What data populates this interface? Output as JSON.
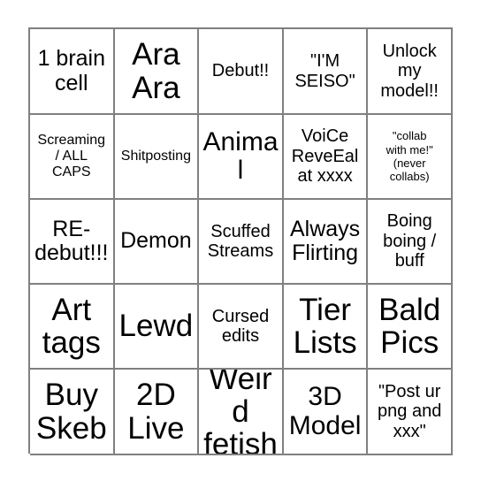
{
  "card": {
    "type": "bingo-card",
    "grid_size": "5x5",
    "border_color": "#808080",
    "background_color": "#ffffff",
    "text_color": "#000000",
    "rows": [
      [
        {
          "text": "1 brain\ncell",
          "size": "lg"
        },
        {
          "text": "Ara\nAra",
          "size": "xxl"
        },
        {
          "text": "Debut!!",
          "size": "md"
        },
        {
          "text": "\"I'M\nSEISO\"",
          "size": "md"
        },
        {
          "text": "Unlock\nmy\nmodel!!",
          "size": "md"
        }
      ],
      [
        {
          "text": "Screaming\n/ ALL\nCAPS",
          "size": "sm"
        },
        {
          "text": "Shitposting",
          "size": "sm"
        },
        {
          "text": "Animal",
          "size": "xl"
        },
        {
          "text": "VoiCe\nReveEal\nat xxxx",
          "size": "md"
        },
        {
          "text": "\"collab\nwith me!\"\n(never\ncollabs)",
          "size": "xs"
        }
      ],
      [
        {
          "text": "RE-\ndebut!!!",
          "size": "lg"
        },
        {
          "text": "Demon",
          "size": "lg"
        },
        {
          "text": "Scuffed\nStreams",
          "size": "md"
        },
        {
          "text": "Always\nFlirting",
          "size": "lg"
        },
        {
          "text": "Boing\nboing /\nbuff",
          "size": "md"
        }
      ],
      [
        {
          "text": "Art\ntags",
          "size": "xxl"
        },
        {
          "text": "Lewd",
          "size": "xxl"
        },
        {
          "text": "Cursed\nedits",
          "size": "md"
        },
        {
          "text": "Tier\nLists",
          "size": "xxl"
        },
        {
          "text": "Bald\nPics",
          "size": "xxl"
        }
      ],
      [
        {
          "text": "Buy\nSkeb",
          "size": "xxl"
        },
        {
          "text": "2D\nLive",
          "size": "xxl"
        },
        {
          "text": "Weird\nfetish",
          "size": "xxl"
        },
        {
          "text": "3D\nModel",
          "size": "xl"
        },
        {
          "text": "\"Post ur\npng and\nxxx\"",
          "size": "md"
        }
      ]
    ]
  }
}
